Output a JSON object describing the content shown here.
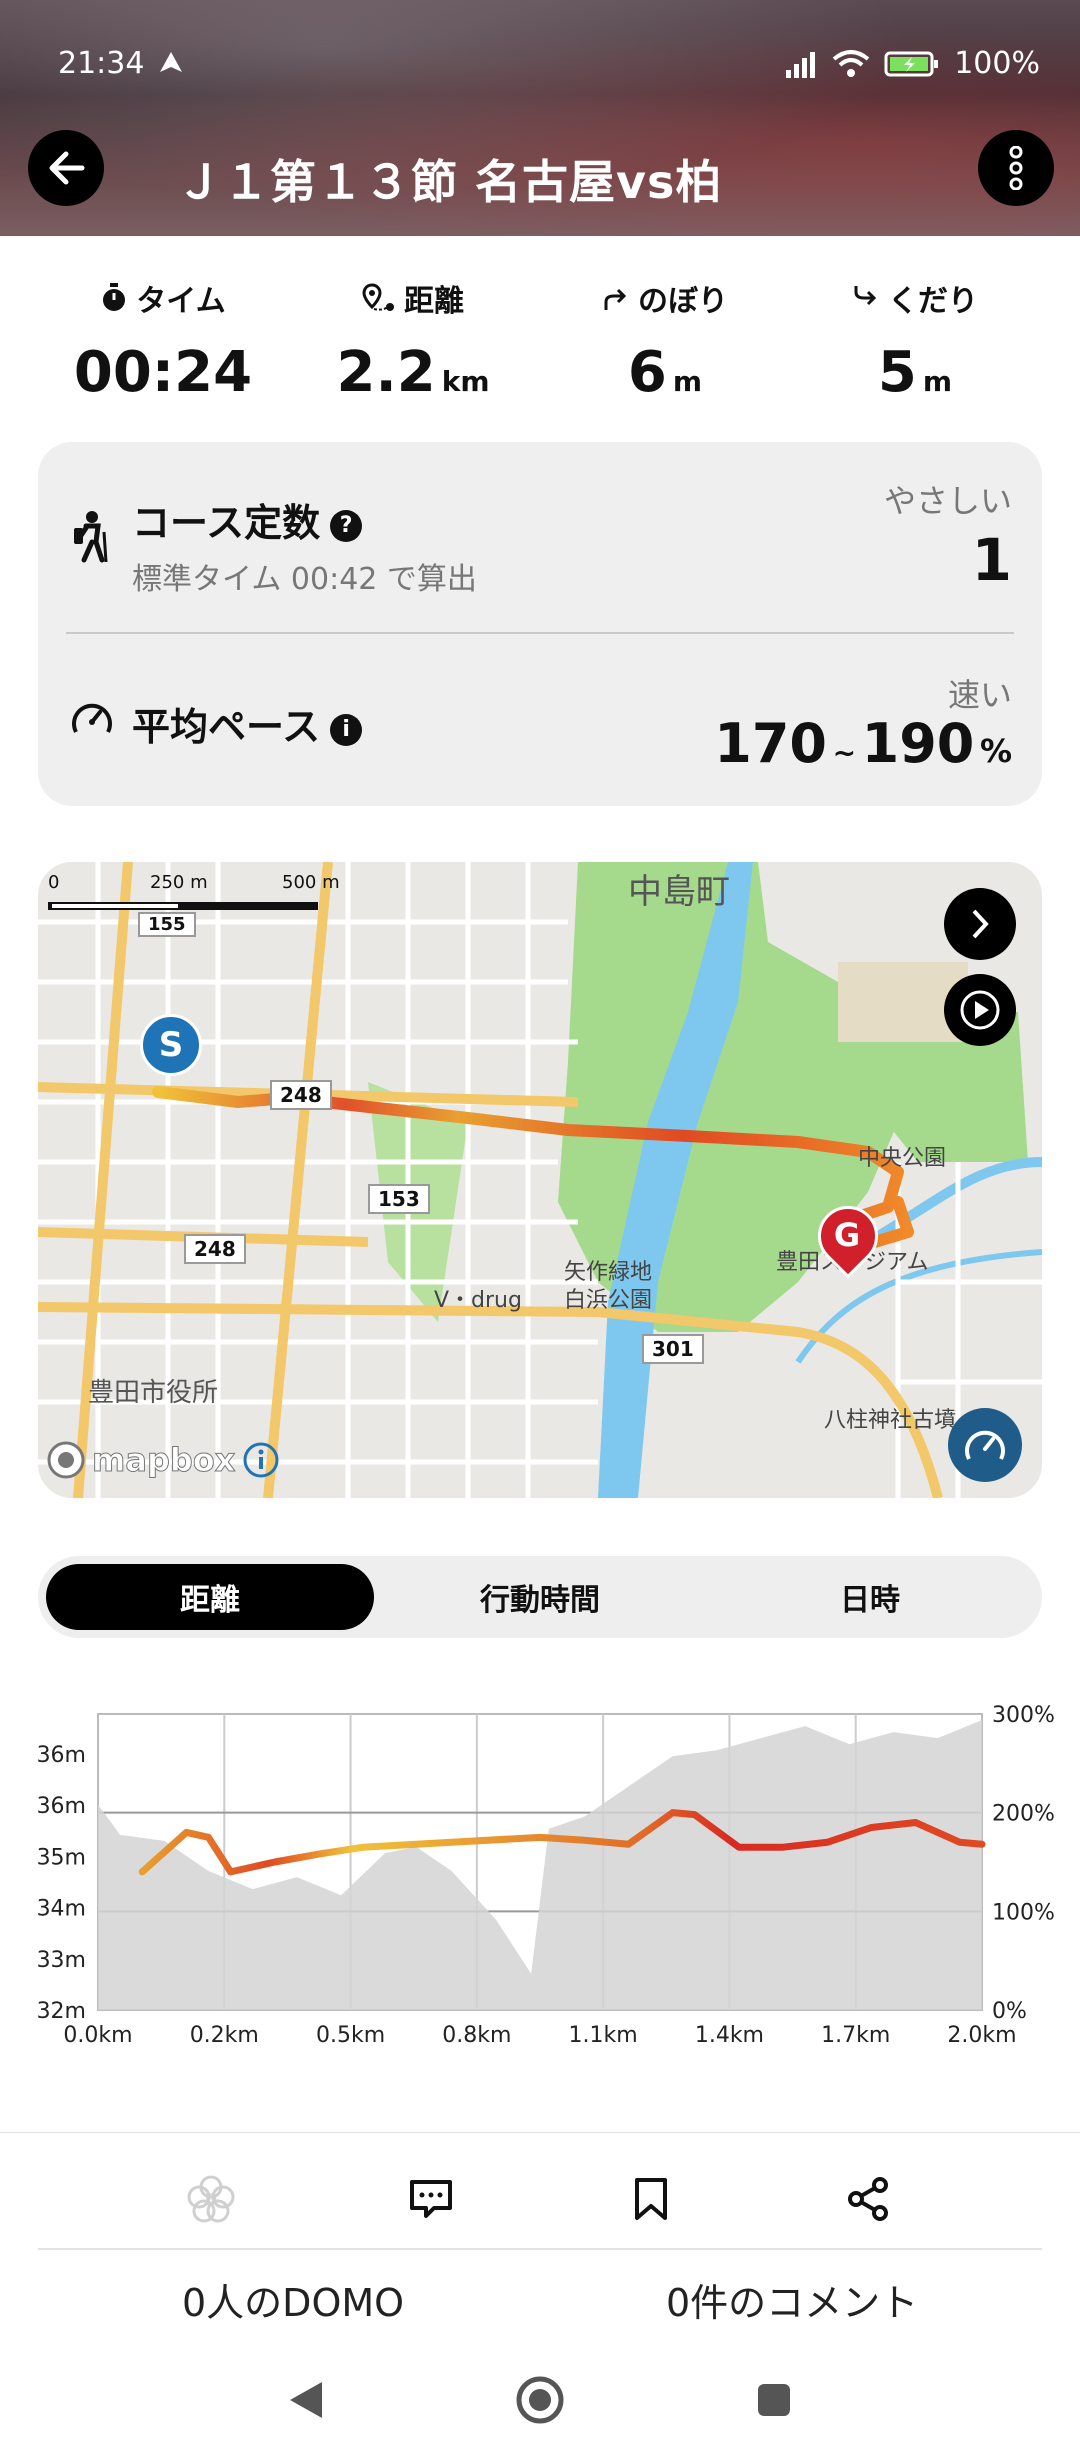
{
  "status_bar": {
    "time": "21:34",
    "battery": "100%"
  },
  "header": {
    "title": "Ｊ１第１３節 名古屋vs柏"
  },
  "stats": [
    {
      "label": "タイム",
      "value": "00:24",
      "unit": ""
    },
    {
      "label": "距離",
      "value": "2.2",
      "unit": "km"
    },
    {
      "label": "のぼり",
      "value": "6",
      "unit": "m"
    },
    {
      "label": "くだり",
      "value": "5",
      "unit": "m"
    }
  ],
  "course": {
    "title": "コース定数",
    "sub": "標準タイム 00:42 で算出",
    "right_label": "やさしい",
    "value": "1"
  },
  "pace": {
    "title": "平均ペース",
    "right_label": "速い",
    "low": "170",
    "sep": "~",
    "high": "190",
    "unit": "%"
  },
  "map": {
    "scale_0": "0",
    "scale_250": "250 m",
    "scale_500": "500 m",
    "labels": {
      "nakajima": "中島町",
      "chuo_park": "中央公園",
      "yahagi": "矢作緑地",
      "shirahama": "白浜公園",
      "stadium": "豊田スタジアム",
      "cityhall": "豊田市役所",
      "yahashira": "八柱神社古墳",
      "vdrug": "V・drug",
      "r153": "153",
      "r248": "248",
      "r301": "301",
      "r248top": "248",
      "r155": "155",
      "mapbox": "mapbox"
    },
    "start_marker": "S",
    "goal_marker": "G"
  },
  "tabs": [
    {
      "label": "距離",
      "active": true
    },
    {
      "label": "行動時間",
      "active": false
    },
    {
      "label": "日時",
      "active": false
    }
  ],
  "chart_data": {
    "type": "area",
    "x_ticks": [
      "0.0km",
      "0.2km",
      "0.5km",
      "0.8km",
      "1.1km",
      "1.4km",
      "1.7km",
      "2.0km"
    ],
    "y_left_ticks": [
      "36m",
      "36m",
      "35m",
      "34m",
      "33m",
      "32m"
    ],
    "y_right_ticks": [
      "300%",
      "200%",
      "100%",
      "0%"
    ],
    "series": [
      {
        "name": "elevation",
        "x": [
          0.0,
          0.05,
          0.15,
          0.25,
          0.35,
          0.45,
          0.55,
          0.65,
          0.72,
          0.8,
          0.9,
          0.98,
          1.02,
          1.1,
          1.2,
          1.3,
          1.4,
          1.5,
          1.6,
          1.7,
          1.8,
          1.9,
          2.0
        ],
        "y": [
          35.4,
          34.9,
          34.8,
          34.3,
          34.0,
          34.2,
          33.9,
          34.6,
          34.7,
          34.3,
          33.5,
          32.6,
          35.0,
          35.2,
          35.7,
          36.2,
          36.3,
          36.5,
          36.7,
          36.4,
          36.6,
          36.5,
          36.8
        ]
      },
      {
        "name": "pace",
        "x": [
          0.1,
          0.2,
          0.25,
          0.3,
          0.4,
          0.5,
          0.6,
          0.8,
          1.0,
          1.1,
          1.2,
          1.3,
          1.35,
          1.45,
          1.55,
          1.65,
          1.75,
          1.85,
          1.95,
          2.0
        ],
        "y": [
          140,
          180,
          175,
          140,
          150,
          158,
          165,
          170,
          175,
          172,
          168,
          200,
          198,
          165,
          165,
          170,
          185,
          190,
          170,
          168
        ]
      }
    ],
    "xlim": [
      0,
      2.0
    ],
    "ylim_left": [
      32,
      36.9
    ],
    "ylim_right": [
      0,
      300
    ],
    "grid": true
  },
  "actions": {
    "domo_count": "0人のDOMO",
    "comment_count": "0件のコメント"
  }
}
